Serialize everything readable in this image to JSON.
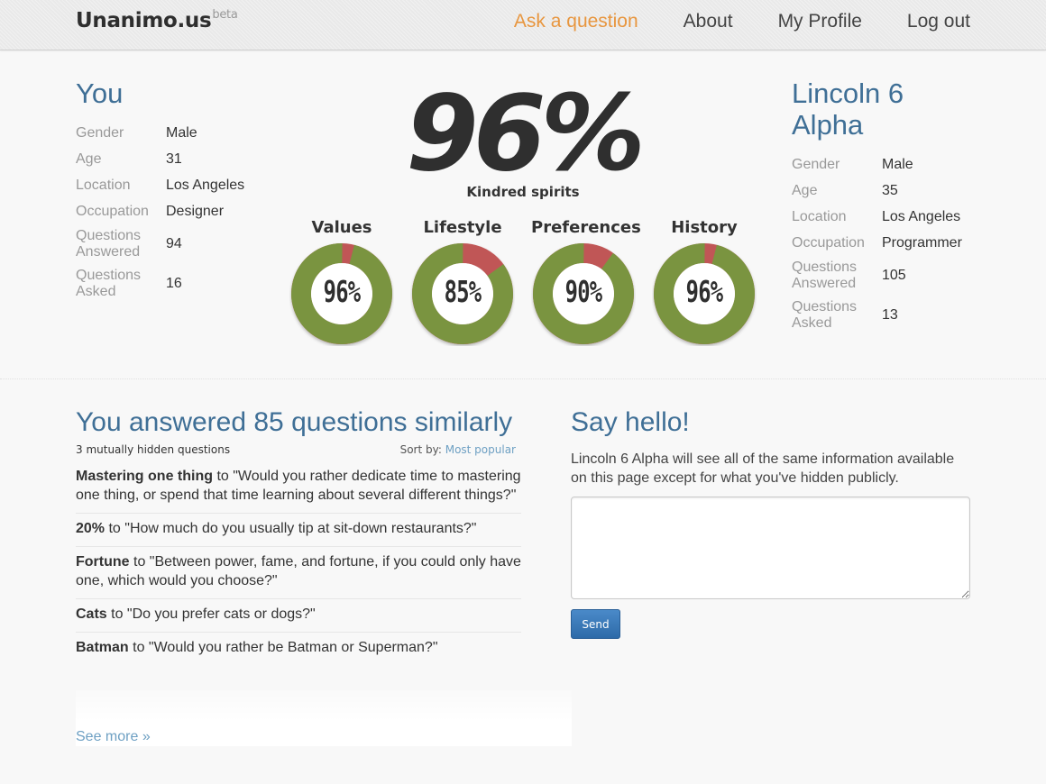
{
  "brand": {
    "name": "Unanimo.us",
    "tag": "beta"
  },
  "nav": [
    {
      "label": "Ask a question",
      "accent": true
    },
    {
      "label": "About"
    },
    {
      "label": "My Profile"
    },
    {
      "label": "Log out"
    }
  ],
  "you": {
    "title": "You",
    "attributes": [
      {
        "key": "Gender",
        "value": "Male"
      },
      {
        "key": "Age",
        "value": "31"
      },
      {
        "key": "Location",
        "value": "Los Angeles"
      },
      {
        "key": "Occupation",
        "value": "Designer"
      },
      {
        "key": "Questions Answered",
        "value": "94"
      },
      {
        "key": "Questions Asked",
        "value": "16"
      }
    ]
  },
  "match": {
    "title": "Lincoln 6 Alpha",
    "attributes": [
      {
        "key": "Gender",
        "value": "Male"
      },
      {
        "key": "Age",
        "value": "35"
      },
      {
        "key": "Location",
        "value": "Los Angeles"
      },
      {
        "key": "Occupation",
        "value": "Programmer"
      },
      {
        "key": "Questions Answered",
        "value": "105"
      },
      {
        "key": "Questions Asked",
        "value": "13"
      }
    ]
  },
  "score": {
    "value": "96%",
    "label": "Kindred spirits",
    "categories": [
      {
        "label": "Values",
        "percent": 96,
        "text": "96%"
      },
      {
        "label": "Lifestyle",
        "percent": 85,
        "text": "85%"
      },
      {
        "label": "Preferences",
        "percent": 90,
        "text": "90%"
      },
      {
        "label": "History",
        "percent": 96,
        "text": "96%"
      }
    ],
    "colors": {
      "match": "#7a9440",
      "mismatch": "#c05656"
    }
  },
  "questions": {
    "title": "You answered 85 questions similarly",
    "hidden_note": "3 mutually hidden questions",
    "sort_label": "Sort by:",
    "sort_value": "Most popular",
    "items": [
      {
        "answer": "Mastering one thing",
        "text": "to \"Would you rather dedicate time to mastering one thing, or spend that time learning about several different things?\""
      },
      {
        "answer": "20%",
        "text": "to \"How much do you usually tip at sit-down restaurants?\""
      },
      {
        "answer": "Fortune",
        "text": "to \"Between power, fame, and fortune, if you could only have one, which would you choose?\""
      },
      {
        "answer": "Cats",
        "text": "to \"Do you prefer cats or dogs?\""
      },
      {
        "answer": "Batman",
        "text": "to \"Would you rather be Batman or Superman?\""
      }
    ],
    "see_more": "See more »"
  },
  "hello": {
    "title": "Say hello!",
    "description": "Lincoln 6 Alpha will see all of the same information available on this page except for what you've hidden publicly.",
    "input_value": "",
    "send_label": "Send"
  }
}
